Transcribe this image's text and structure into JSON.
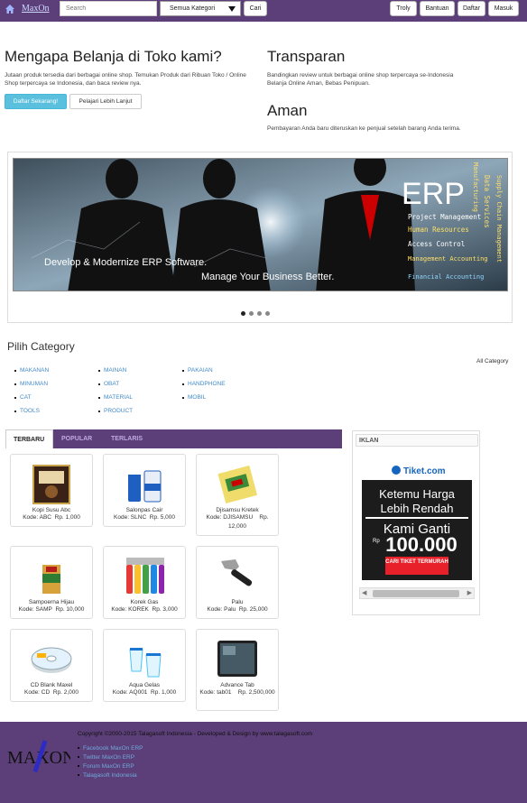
{
  "topbar": {
    "brand": "MaxOn",
    "search_placeholder": "Search",
    "category_select": "Semua Kategori",
    "search_button": "Cari",
    "nav": [
      "Troly",
      "Bantuan",
      "Daftar",
      "Masuk"
    ]
  },
  "hero": {
    "title": "Mengapa Belanja di Toko kami?",
    "desc": "Jutaan produk tersedia dari berbagai online shop. Temukan Produk dari Ribuan Toko / Online Shop terpercaya se Indonesia, dan baca review nya.",
    "register_button": "Daftar Sekarang!",
    "learn_button": "Pelajari Lebih Lanjut"
  },
  "features": [
    {
      "title": "Transparan",
      "desc": "Bandingkan review untuk berbagai online shop terpercaya se-Indonesia Belanja Online Aman, Bebas Penipuan."
    },
    {
      "title": "Aman",
      "desc": "Pembayaran Anda baru diteruskan ke penjual setelah barang Anda terima."
    }
  ],
  "banner": {
    "headline": "ERP",
    "tagline1": "Develop & Modernize ERP Software.",
    "tagline2": "Manage Your Business Better.",
    "modules": [
      "Project Management",
      "Human Resources",
      "Access Control",
      "Management Accounting",
      "Financial Accounting"
    ],
    "vertical": [
      "Manufacturing",
      "Data Services",
      "Supply Chain Management"
    ],
    "slides": 4,
    "active_slide": 1
  },
  "categories": {
    "title": "Pilih Category",
    "all_label": "All Category",
    "columns": [
      [
        "MAKANAN",
        "MINUMAN",
        "CAT",
        "TOOLS"
      ],
      [
        "MAINAN",
        "OBAT",
        "MATERIAL",
        "PRODUCT"
      ],
      [
        "PAKAIAN",
        "HANDPHONE",
        "MOBIL"
      ]
    ]
  },
  "tabs": [
    "TERBARU",
    "POPULAR",
    "TERLARIS"
  ],
  "products": [
    {
      "name": "Kopi Susu Abc",
      "code": "Kode: ABC",
      "price": "Rp. 1,000",
      "icon": "coffee-pack-icon"
    },
    {
      "name": "Salonpas Cair",
      "code": "Kode: SLNC",
      "price": "Rp. 5,000",
      "icon": "salonpas-icon"
    },
    {
      "name": "Djisamsu Kretek",
      "code": "Kode: DJISAMSU",
      "price": "Rp. 12,000",
      "icon": "cigarette-pack-icon"
    },
    {
      "name": "Sampoerna Hijau",
      "code": "Kode: SAMP",
      "price": "Rp. 10,000",
      "icon": "cigarette-pack-icon"
    },
    {
      "name": "Korek Gas",
      "code": "Kode: KOREK",
      "price": "Rp. 3,000",
      "icon": "lighter-icon"
    },
    {
      "name": "Palu",
      "code": "Kode: Palu",
      "price": "Rp. 25,000",
      "icon": "hammer-icon"
    },
    {
      "name": "CD Blank Maxel",
      "code": "Kode: CD",
      "price": "Rp. 2,000",
      "icon": "cd-icon"
    },
    {
      "name": "Aqua Gelas",
      "code": "Kode: AQ001",
      "price": "Rp. 1,000",
      "icon": "water-cup-icon"
    },
    {
      "name": "Advance Tab",
      "code": "Kode: tab01",
      "price": "Rp. 2,500,000",
      "icon": "tablet-icon"
    }
  ],
  "iklan": {
    "title": "IKLAN",
    "ad_brand": "Tiket.com",
    "ad_line1": "Ketemu Harga",
    "ad_line2": "Lebih Rendah",
    "ad_line3": "Kami Ganti",
    "ad_currency": "Rp",
    "ad_amount": "100.000",
    "ad_cta": "CARI TIKET TERMURAH"
  },
  "footer": {
    "logo": "MAXON",
    "copyright": "Copyright ©2000-2015 Talagasoft Indonesia - Developed & Design by www.talagasoft.com",
    "links": [
      "Facebook MaxOn ERP",
      "Twitter MaxOn ERP",
      "Forum MaxOn ERP",
      "Talagasoft Indonesia"
    ]
  },
  "colors": {
    "brand": "#5c3f78",
    "link": "#428bca",
    "info_button": "#5bc0de",
    "ad_red": "#e8202a"
  }
}
